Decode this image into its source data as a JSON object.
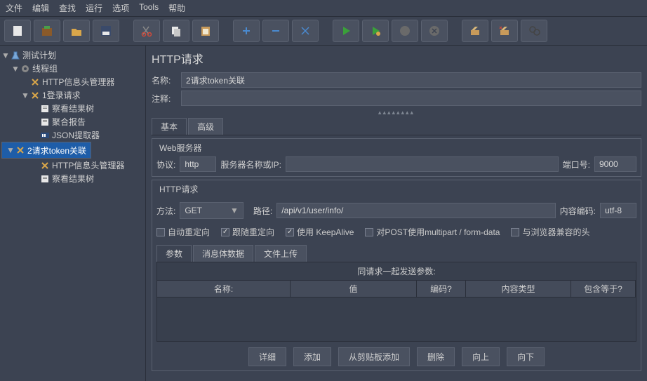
{
  "menubar": [
    "文件",
    "编辑",
    "查找",
    "运行",
    "选项",
    "Tools",
    "帮助"
  ],
  "tree": [
    {
      "indent": 0,
      "tw": "▼",
      "icon": "beaker",
      "label": "测试计划"
    },
    {
      "indent": 1,
      "tw": "▼",
      "icon": "gear",
      "label": "线程组"
    },
    {
      "indent": 2,
      "tw": "",
      "icon": "xx",
      "label": "HTTP信息头管理器"
    },
    {
      "indent": 2,
      "tw": "▼",
      "icon": "xx",
      "label": "1登录请求"
    },
    {
      "indent": 3,
      "tw": "",
      "icon": "doc",
      "label": "察看结果树"
    },
    {
      "indent": 3,
      "tw": "",
      "icon": "doc",
      "label": "聚合报告"
    },
    {
      "indent": 3,
      "tw": "",
      "icon": "json",
      "label": "JSON提取器"
    },
    {
      "indent": 2,
      "tw": "▼",
      "icon": "xx",
      "label": "2请求token关联",
      "sel": true
    },
    {
      "indent": 3,
      "tw": "",
      "icon": "xx",
      "label": "HTTP信息头管理器"
    },
    {
      "indent": 3,
      "tw": "",
      "icon": "doc",
      "label": "察看结果树"
    }
  ],
  "panel": {
    "title": "HTTP请求",
    "name_lbl": "名称:",
    "name_val": "2请求token关联",
    "comment_lbl": "注释:",
    "comment_val": "",
    "tabs": {
      "basic": "基本",
      "advanced": "高级"
    },
    "web": {
      "legend": "Web服务器",
      "proto_lbl": "协议:",
      "proto": "http",
      "host_lbl": "服务器名称或IP:",
      "host": "",
      "port_lbl": "端口号:",
      "port": "9000"
    },
    "http": {
      "legend": "HTTP请求",
      "method_lbl": "方法:",
      "method": "GET",
      "path_lbl": "路径:",
      "path": "/api/v1/user/info/",
      "enc_lbl": "内容编码:",
      "enc": "utf-8"
    },
    "checks": {
      "auto": "自动重定向",
      "follow": "跟随重定向",
      "keep": "使用 KeepAlive",
      "multi": "对POST使用multipart / form-data",
      "compat": "与浏览器兼容的头"
    },
    "param_tabs": {
      "params": "参数",
      "body": "消息体数据",
      "upload": "文件上传"
    },
    "param_title": "同请求一起发送参数:",
    "param_cols": {
      "name": "名称:",
      "value": "值",
      "enc": "编码?",
      "ctype": "内容类型",
      "inc": "包含等于?"
    },
    "buttons": {
      "detail": "详细",
      "add": "添加",
      "paste": "从剪贴板添加",
      "del": "删除",
      "up": "向上",
      "down": "向下"
    }
  }
}
